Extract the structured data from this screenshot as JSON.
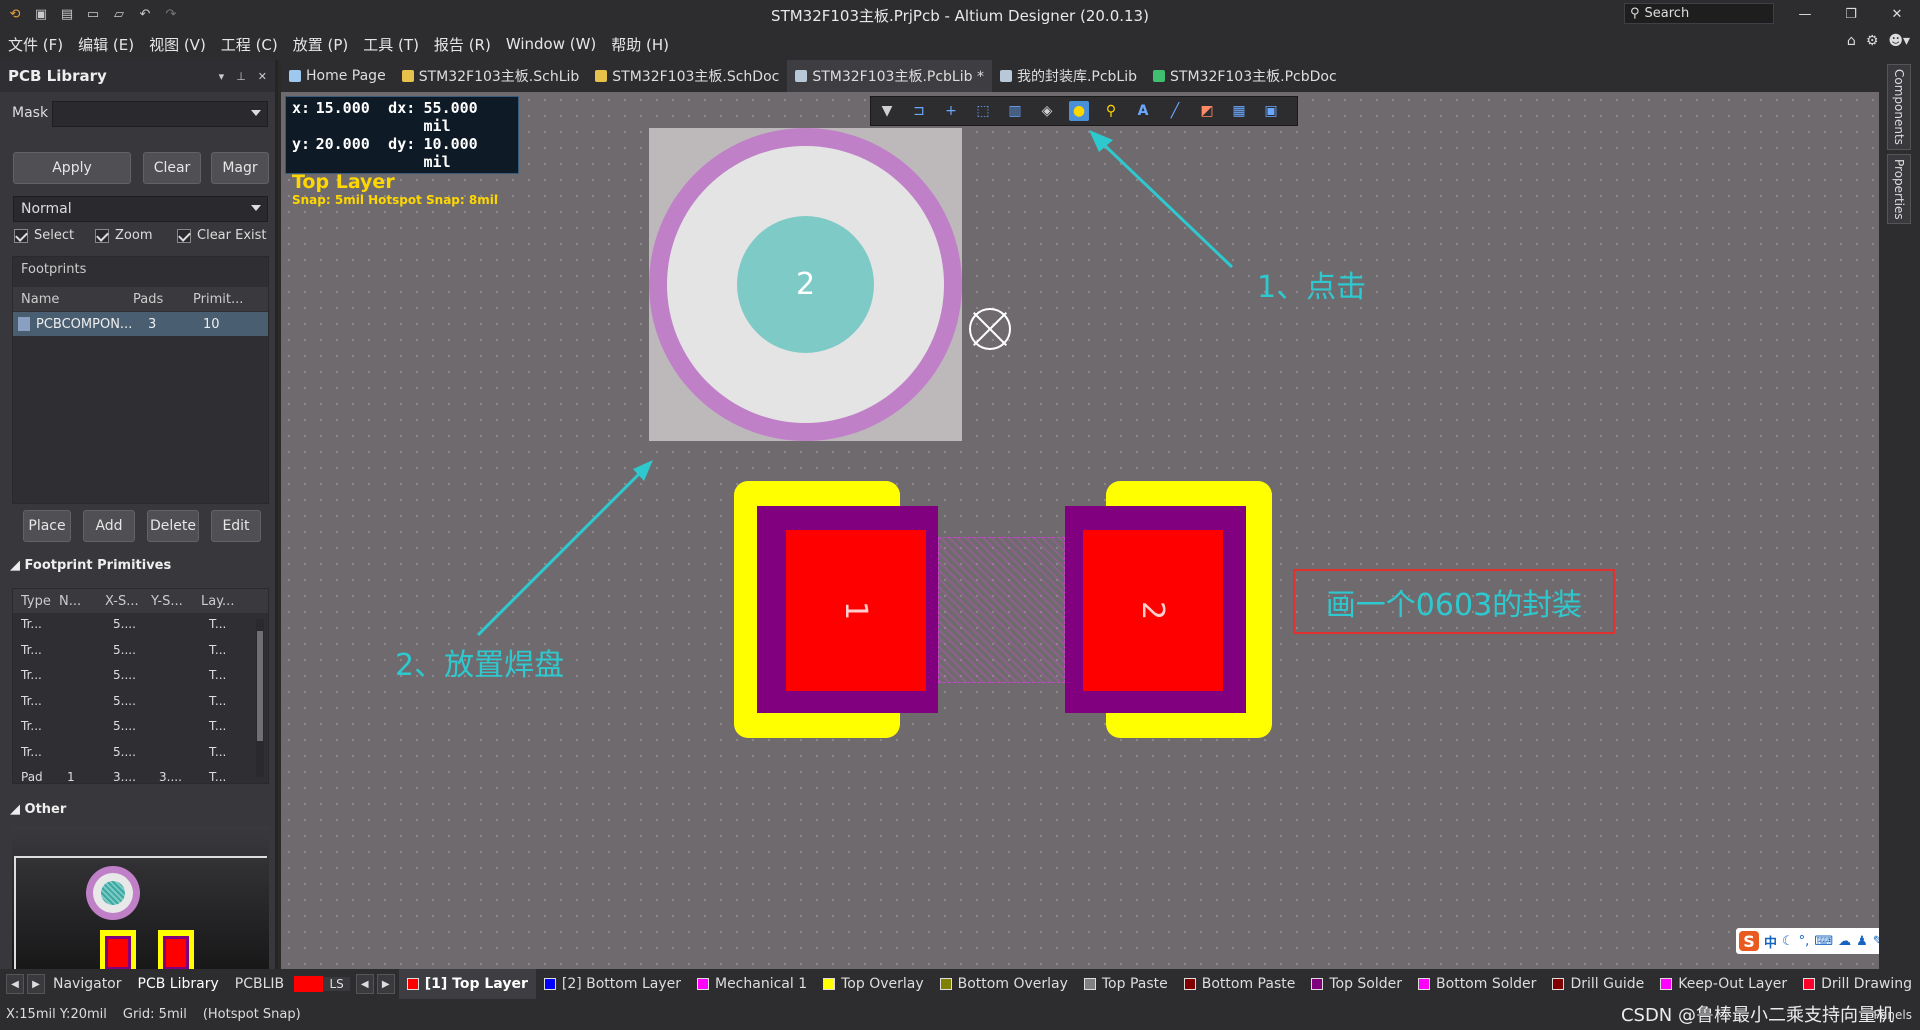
{
  "titlebar": {
    "title": "STM32F103主板.PrjPcb - Altium Designer (20.0.13)",
    "search_placeholder": "Search",
    "quick_icons": [
      "app-icon",
      "save-icon",
      "save-all-icon",
      "open-icon",
      "open-folder-icon",
      "undo-icon",
      "redo-icon"
    ]
  },
  "menubar": {
    "items": [
      "文件 (F)",
      "编辑 (E)",
      "视图 (V)",
      "工程 (C)",
      "放置 (P)",
      "工具 (T)",
      "报告 (R)",
      "Window (W)",
      "帮助 (H)"
    ]
  },
  "left_panel": {
    "title": "PCB Library",
    "mask_label": "Mask",
    "mask_value": "",
    "buttons": {
      "apply": "Apply",
      "clear": "Clear",
      "magnify": "Magr"
    },
    "mode_value": "Normal",
    "checks": {
      "select": "Select",
      "zoom": "Zoom",
      "clear_existing": "Clear Exist"
    },
    "footprints": {
      "title": "Footprints",
      "columns": [
        "Name",
        "Pads",
        "Primit..."
      ],
      "rows": [
        {
          "name": "PCBCOMPON...",
          "pads": "3",
          "prims": "10"
        }
      ]
    },
    "fp_buttons": {
      "place": "Place",
      "add": "Add",
      "delete": "Delete",
      "edit": "Edit"
    },
    "primitives": {
      "title": "Footprint Primitives",
      "columns": [
        "Type",
        "N...",
        "X-S...",
        "Y-S...",
        "Lay..."
      ],
      "rows": [
        {
          "type": "Tr...",
          "n": "",
          "xs": "5....",
          "ys": "",
          "lay": "T..."
        },
        {
          "type": "Tr...",
          "n": "",
          "xs": "5....",
          "ys": "",
          "lay": "T..."
        },
        {
          "type": "Tr...",
          "n": "",
          "xs": "5....",
          "ys": "",
          "lay": "T..."
        },
        {
          "type": "Tr...",
          "n": "",
          "xs": "5....",
          "ys": "",
          "lay": "T..."
        },
        {
          "type": "Tr...",
          "n": "",
          "xs": "5....",
          "ys": "",
          "lay": "T..."
        },
        {
          "type": "Tr...",
          "n": "",
          "xs": "5....",
          "ys": "",
          "lay": "T..."
        },
        {
          "type": "Pad",
          "n": "1",
          "xs": "3....",
          "ys": "3....",
          "lay": "T..."
        }
      ]
    },
    "other_title": "Other"
  },
  "doc_tabs": [
    {
      "label": "Home Page",
      "icon": "home-icon",
      "color": "#9ec8f0"
    },
    {
      "label": "STM32F103主板.SchLib",
      "icon": "schlib-icon",
      "color": "#e7c24a"
    },
    {
      "label": "STM32F103主板.SchDoc",
      "icon": "schdoc-icon",
      "color": "#e7c24a"
    },
    {
      "label": "STM32F103主板.PcbLib *",
      "icon": "pcblib-icon",
      "color": "#b8c8d8",
      "active": true
    },
    {
      "label": "我的封装库.PcbLib",
      "icon": "pcblib-icon",
      "color": "#b8c8d8"
    },
    {
      "label": "STM32F103主板.PcbDoc",
      "icon": "pcbdoc-icon",
      "color": "#3fbf6f"
    }
  ],
  "hud": {
    "x_label": "x:",
    "x_value": "15.000",
    "dx_label": "dx:",
    "dx_value": "55.000 mil",
    "y_label": "y:",
    "y_value": "20.000",
    "dy_label": "dy:",
    "dy_value": "10.000 mil",
    "layer": "Top Layer",
    "snap": "Snap: 5mil Hotspot Snap: 8mil"
  },
  "active_bar": {
    "icons": [
      "filter-icon",
      "route-icon",
      "cross-icon",
      "select-rect-icon",
      "align-icon",
      "component-icon",
      "pad-icon",
      "via-icon",
      "text-icon",
      "line-icon",
      "region-icon",
      "graph-icon",
      "dimension-icon"
    ],
    "selected": "pad-icon"
  },
  "canvas": {
    "round_pad_label": "2",
    "pad1_label": "1",
    "pad2_label": "2",
    "colors": {
      "top_layer": "#ff0000",
      "top_solder": "#800080",
      "top_overlay": "#ffff00",
      "pad_ring": "#c080c8",
      "pad_hole": "#7ecac6",
      "annotation": "#2ec9cf",
      "note_box": "#e03030"
    }
  },
  "annotations": {
    "step1": "1、点击",
    "step2": "2、放置焊盘",
    "note": "画一个0603的封装"
  },
  "right_tabs": [
    "Components",
    "Properties"
  ],
  "bottom_tabs": [
    "Navigator",
    "PCB Library",
    "PCBLIB"
  ],
  "ls_label": "LS",
  "layers": [
    {
      "label": "[1] Top Layer",
      "color": "#ff0000",
      "active": true
    },
    {
      "label": "[2] Bottom Layer",
      "color": "#0000ff"
    },
    {
      "label": "Mechanical 1",
      "color": "#ff00ff"
    },
    {
      "label": "Top Overlay",
      "color": "#ffff00"
    },
    {
      "label": "Bottom Overlay",
      "color": "#808000"
    },
    {
      "label": "Top Paste",
      "color": "#808080"
    },
    {
      "label": "Bottom Paste",
      "color": "#800000"
    },
    {
      "label": "Top Solder",
      "color": "#800080"
    },
    {
      "label": "Bottom Solder",
      "color": "#ff00ff"
    },
    {
      "label": "Drill Guide",
      "color": "#800000"
    },
    {
      "label": "Keep-Out Layer",
      "color": "#ff00ff"
    },
    {
      "label": "Drill Drawing",
      "color": "#ff002a"
    }
  ],
  "statusbar": {
    "coords": "X:15mil Y:20mil",
    "grid": "Grid: 5mil",
    "snap": "(Hotspot Snap)",
    "panels": "Panels"
  },
  "watermark": "CSDN @鲁棒最小二乘支持向量机",
  "ime": {
    "logo": "S",
    "mode": "中"
  }
}
